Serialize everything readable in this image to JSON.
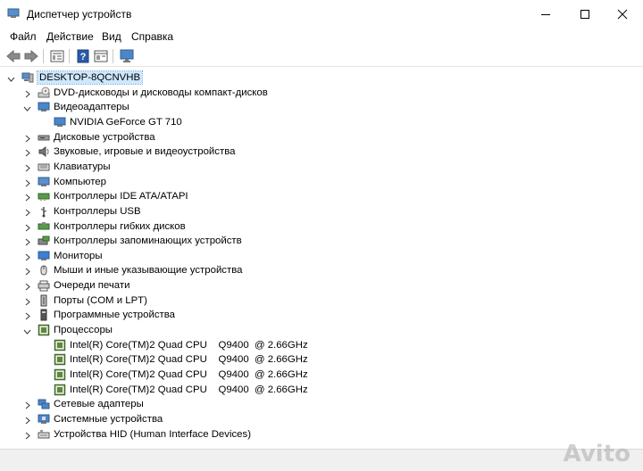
{
  "window": {
    "title": "Диспетчер устройств"
  },
  "menu": [
    "Файл",
    "Действие",
    "Вид",
    "Справка"
  ],
  "toolbar": [
    "back-icon",
    "forward-icon",
    "properties-icon",
    "help-icon",
    "view-icon",
    "monitor-icon"
  ],
  "tree": {
    "root": "DESKTOP-8QCNVHB",
    "items": [
      {
        "label": "DVD-дисководы и дисководы компакт-дисков",
        "icon": "dvd-drive-icon",
        "state": "collapsed"
      },
      {
        "label": "Видеоадаптеры",
        "icon": "display-adapter-icon",
        "state": "expanded",
        "children": [
          "NVIDIA GeForce GT 710"
        ]
      },
      {
        "label": "Дисковые устройства",
        "icon": "disk-drive-icon",
        "state": "collapsed"
      },
      {
        "label": "Звуковые, игровые и видеоустройства",
        "icon": "speaker-icon",
        "state": "collapsed"
      },
      {
        "label": "Клавиатуры",
        "icon": "keyboard-icon",
        "state": "collapsed"
      },
      {
        "label": "Компьютер",
        "icon": "computer-icon",
        "state": "collapsed"
      },
      {
        "label": "Контроллеры IDE ATA/ATAPI",
        "icon": "ide-controller-icon",
        "state": "collapsed"
      },
      {
        "label": "Контроллеры USB",
        "icon": "usb-icon",
        "state": "collapsed"
      },
      {
        "label": "Контроллеры гибких дисков",
        "icon": "floppy-controller-icon",
        "state": "collapsed"
      },
      {
        "label": "Контроллеры запоминающих устройств",
        "icon": "storage-controller-icon",
        "state": "collapsed"
      },
      {
        "label": "Мониторы",
        "icon": "monitor-icon",
        "state": "collapsed"
      },
      {
        "label": "Мыши и иные указывающие устройства",
        "icon": "mouse-icon",
        "state": "collapsed"
      },
      {
        "label": "Очереди печати",
        "icon": "printer-icon",
        "state": "collapsed"
      },
      {
        "label": "Порты (COM и LPT)",
        "icon": "port-icon",
        "state": "collapsed"
      },
      {
        "label": "Программные устройства",
        "icon": "software-device-icon",
        "state": "collapsed"
      },
      {
        "label": "Процессоры",
        "icon": "processor-icon",
        "state": "expanded",
        "children": [
          "Intel(R) Core(TM)2 Quad CPU    Q9400  @ 2.66GHz",
          "Intel(R) Core(TM)2 Quad CPU    Q9400  @ 2.66GHz",
          "Intel(R) Core(TM)2 Quad CPU    Q9400  @ 2.66GHz",
          "Intel(R) Core(TM)2 Quad CPU    Q9400  @ 2.66GHz"
        ]
      },
      {
        "label": "Сетевые адаптеры",
        "icon": "network-adapter-icon",
        "state": "collapsed"
      },
      {
        "label": "Системные устройства",
        "icon": "system-device-icon",
        "state": "collapsed"
      },
      {
        "label": "Устройства HID (Human Interface Devices)",
        "icon": "hid-icon",
        "state": "collapsed"
      }
    ]
  },
  "watermark": "Avito",
  "colors": {
    "selection": "#cce8ff",
    "chevron": "#404040"
  }
}
